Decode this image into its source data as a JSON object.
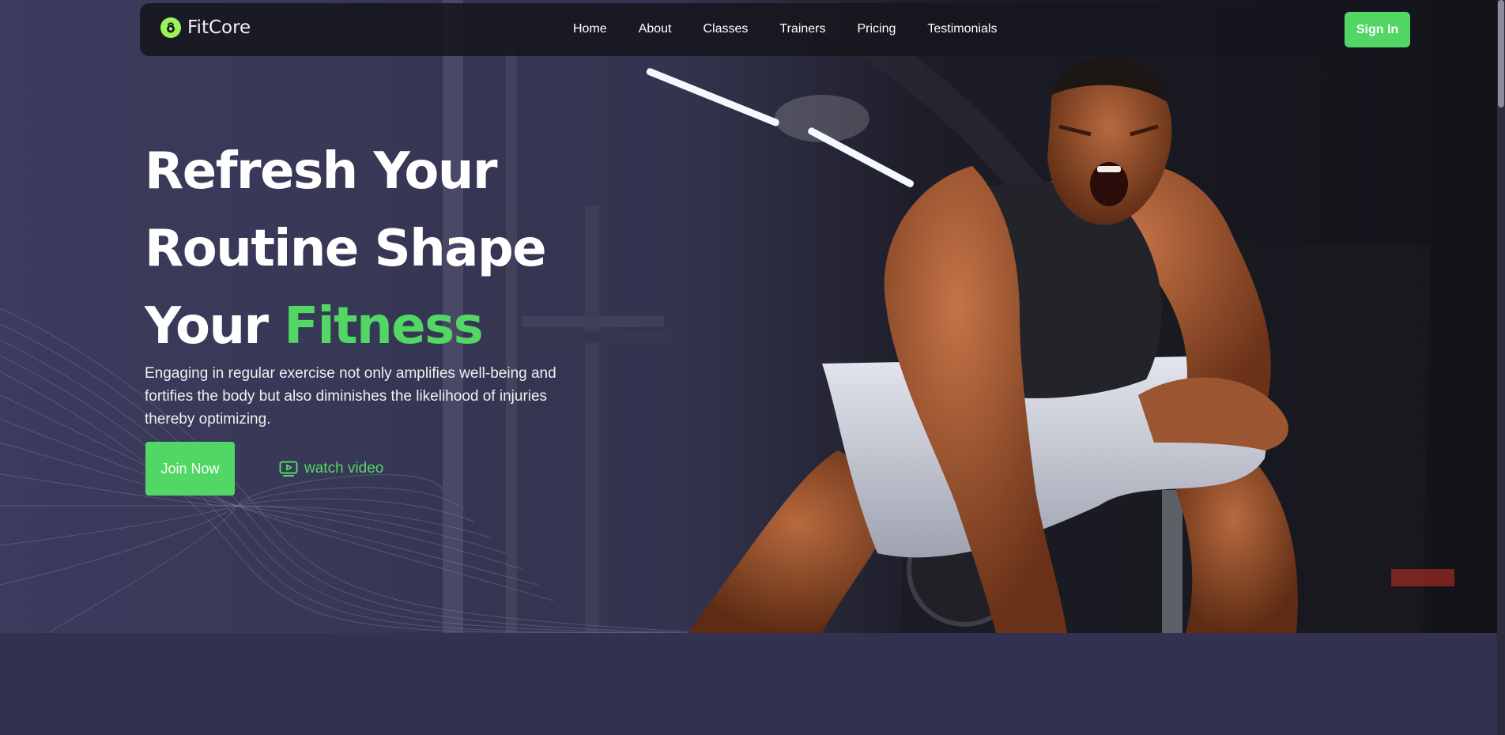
{
  "brand": {
    "name": "FitCore",
    "icon": "kettlebell-icon"
  },
  "nav": {
    "links": [
      "Home",
      "About",
      "Classes",
      "Trainers",
      "Pricing",
      "Testimonials"
    ],
    "signin_label": "Sign In"
  },
  "hero": {
    "title_line1": "Refresh Your",
    "title_line2": "Routine Shape",
    "title_line3_plain": "Your ",
    "title_line3_accent": "Fitness",
    "text": "Engaging in regular exercise not only amplifies well-being and fortifies the body but also diminishes the likelihood of injuries thereby optimizing.",
    "join_label": "Join Now",
    "watch_label": "watch video",
    "watch_icon": "play-video-icon"
  },
  "colors": {
    "accent": "#52d765",
    "background": "#323150",
    "navbar": "#16161e"
  }
}
